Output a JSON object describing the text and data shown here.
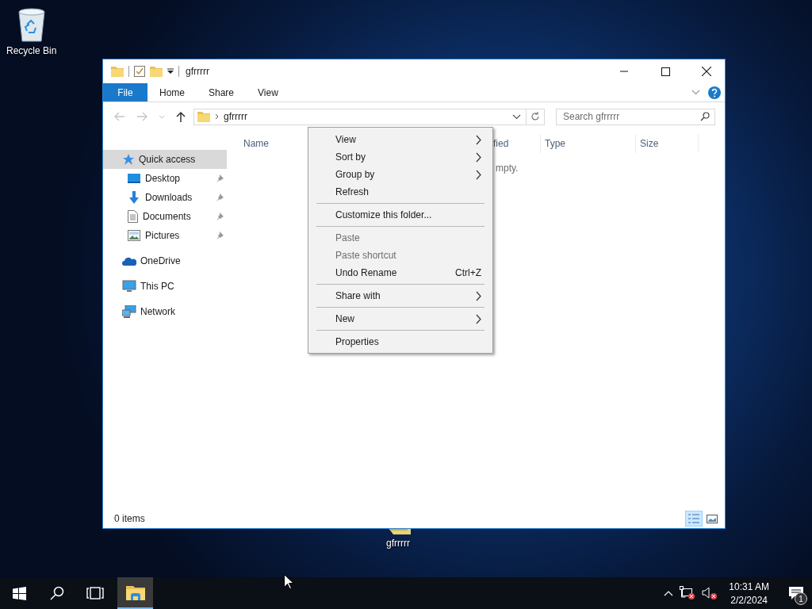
{
  "desktop_icons": [
    {
      "kind": "recycle",
      "label": "Recycle Bin"
    },
    {
      "kind": "folder",
      "label": "gfrrrrr"
    }
  ],
  "window": {
    "title": "gfrrrrr",
    "ribbon_tabs": [
      {
        "kind": "file",
        "label": "File"
      },
      {
        "kind": "tab",
        "label": "Home"
      },
      {
        "kind": "tab",
        "label": "Share"
      },
      {
        "kind": "tab",
        "label": "View"
      }
    ],
    "address": {
      "path": "gfrrrrr"
    },
    "search": {
      "placeholder": "Search gfrrrrr"
    },
    "sidebar": [
      {
        "label": "Quick access",
        "kind": "star",
        "selected": true,
        "children": [
          {
            "label": "Desktop",
            "kind": "desktop",
            "selected": false,
            "pinned": true
          },
          {
            "label": "Downloads",
            "kind": "download",
            "selected": false,
            "pinned": true
          },
          {
            "label": "Documents",
            "kind": "document",
            "selected": false,
            "pinned": true
          },
          {
            "label": "Pictures",
            "kind": "pictures",
            "selected": false,
            "pinned": true
          }
        ]
      },
      {
        "label": "OneDrive",
        "kind": "cloud",
        "selected": false
      },
      {
        "label": "This PC",
        "kind": "pc",
        "selected": false
      },
      {
        "label": "Network",
        "kind": "network",
        "selected": false
      }
    ],
    "columns": [
      {
        "label": "Name"
      },
      {
        "label": "fied"
      },
      {
        "label": "Type"
      },
      {
        "label": "Size"
      }
    ],
    "empty_message": "mpty.",
    "status_bar": {
      "text": "0 items",
      "views": [
        {
          "kind": "details",
          "selected": true
        },
        {
          "kind": "tiles",
          "selected": false
        }
      ]
    }
  },
  "context_menu": [
    {
      "kind": "item",
      "label": "View",
      "submenu": true,
      "disabled": false
    },
    {
      "kind": "item",
      "label": "Sort by",
      "submenu": true,
      "disabled": false
    },
    {
      "kind": "item",
      "label": "Group by",
      "submenu": true,
      "disabled": false
    },
    {
      "kind": "item",
      "label": "Refresh",
      "submenu": false,
      "disabled": false
    },
    {
      "kind": "separator"
    },
    {
      "kind": "item",
      "label": "Customize this folder...",
      "submenu": false,
      "disabled": false
    },
    {
      "kind": "separator"
    },
    {
      "kind": "item",
      "label": "Paste",
      "submenu": false,
      "disabled": true
    },
    {
      "kind": "item",
      "label": "Paste shortcut",
      "submenu": false,
      "disabled": true
    },
    {
      "kind": "item",
      "label": "Undo Rename",
      "shortcut": "Ctrl+Z",
      "submenu": false,
      "disabled": false
    },
    {
      "kind": "separator"
    },
    {
      "kind": "item",
      "label": "Share with",
      "submenu": true,
      "disabled": false
    },
    {
      "kind": "separator"
    },
    {
      "kind": "item",
      "label": "New",
      "submenu": true,
      "disabled": false
    },
    {
      "kind": "separator"
    },
    {
      "kind": "item",
      "label": "Properties",
      "submenu": false,
      "disabled": false
    }
  ],
  "taskbar": {
    "apps": [
      {
        "kind": "start",
        "active": false
      },
      {
        "kind": "search",
        "active": false
      },
      {
        "kind": "taskview",
        "active": false
      },
      {
        "kind": "explorer",
        "active": true
      }
    ],
    "clock": {
      "time": "10:31 AM",
      "date": "2/2/2024"
    },
    "notifications": {
      "count": "1"
    }
  }
}
